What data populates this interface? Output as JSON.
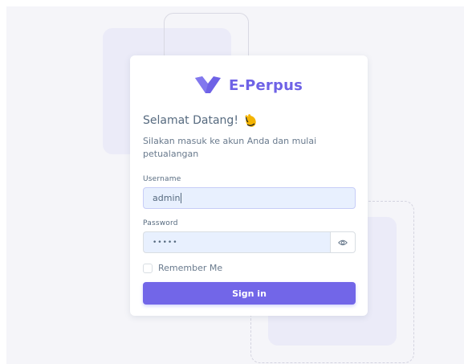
{
  "brand": {
    "name": "E-Perpus",
    "logo_icon": "e-perpus-logo-icon",
    "color": "#6e62e6"
  },
  "welcome": {
    "title": "Selamat Datang!",
    "emoji_icon": "waving-hand-icon",
    "subtitle": "Silakan masuk ke akun Anda dan mulai petualangan"
  },
  "form": {
    "username": {
      "label": "Username",
      "value": "admin"
    },
    "password": {
      "label": "Password",
      "value": "•••••",
      "toggle_icon": "eye-icon"
    },
    "remember": {
      "label": "Remember Me",
      "checked": false
    },
    "submit_label": "Sign in"
  },
  "colors": {
    "primary": "#7266e8",
    "input_autofill_bg": "#e8f0fe",
    "page_bg": "#f5f5f9"
  }
}
